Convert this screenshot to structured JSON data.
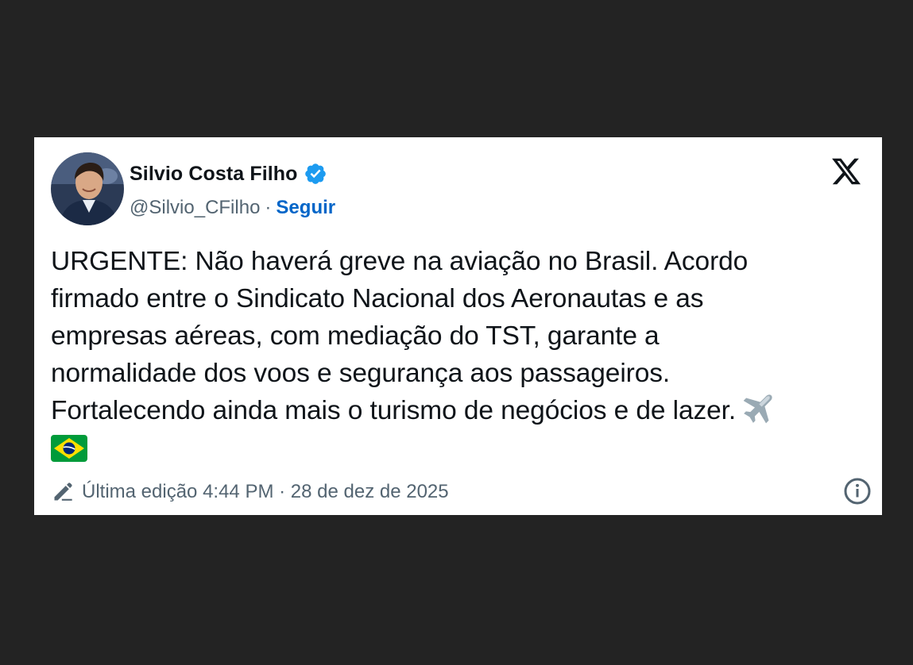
{
  "author": {
    "name": "Silvio Costa Filho",
    "handle": "@Silvio_CFilho",
    "separator": "·",
    "follow_label": "Seguir",
    "verified_color": "#1d9bf0"
  },
  "platform_icon": "x-logo-icon",
  "tweet": {
    "lines": [
      "URGENTE: Não haverá greve na aviação no Brasil. Acordo",
      "firmado entre o Sindicato Nacional dos Aeronautas e as",
      "empresas aéreas, com mediação do TST, garante a",
      "normalidade dos voos e segurança aos passageiros.",
      "Fortalecendo ainda mais o turismo de negócios e de lazer."
    ],
    "emojis": [
      "airplane-emoji",
      "brazil-flag-emoji"
    ]
  },
  "footer": {
    "edit_label": "Última edição 4:44 PM · 28 de dez de 2025"
  },
  "colors": {
    "background": "#232323",
    "card": "#ffffff",
    "text": "#0f1419",
    "muted": "#536471",
    "link": "#0065c8"
  }
}
